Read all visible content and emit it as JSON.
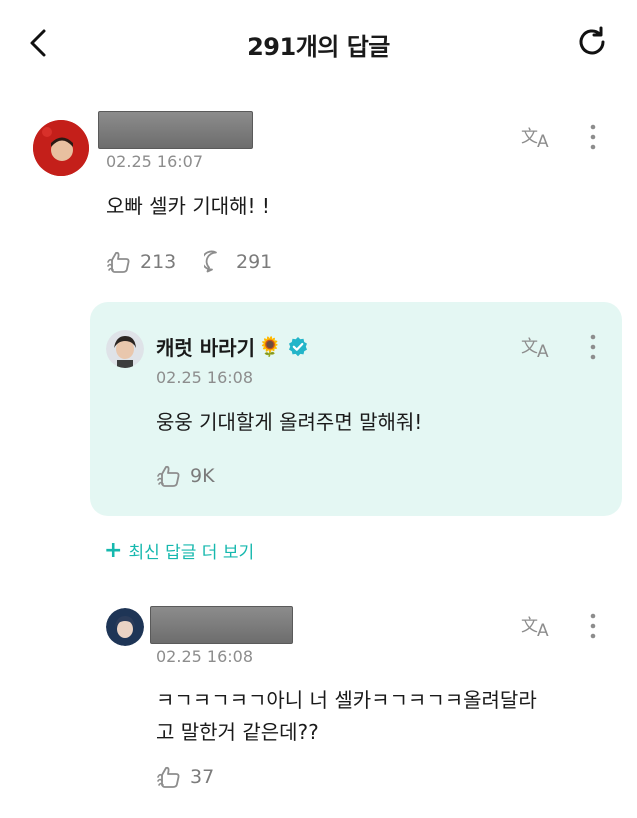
{
  "header": {
    "title": "291개의 답글",
    "back_icon": "chevron-left-icon",
    "refresh_icon": "refresh-icon"
  },
  "comment": {
    "timestamp": "02.25 16:07",
    "text": "오빠 셀카 기대해! !",
    "likes": "213",
    "replies": "291"
  },
  "reply": {
    "author": "캐럿 바라기",
    "author_emoji": "🌻",
    "verified_icon": "verified-badge-icon",
    "timestamp": "02.25 16:08",
    "text": "웅웅 기대할게 올려주면 말해줘!",
    "likes": "9K"
  },
  "more_replies_label": "최신 답글 더 보기",
  "comment2": {
    "timestamp": "02.25 16:08",
    "text_line1": "ㅋㄱㅋㄱㅋㄱ아니 너 셀카ㅋㄱㅋㄱㅋ올려달라",
    "text_line2": "고 말한거 같은데??",
    "likes": "37"
  },
  "colors": {
    "accent": "#16b8ae",
    "reply_bg": "#e4f7f3",
    "muted": "#8d8d8d"
  }
}
